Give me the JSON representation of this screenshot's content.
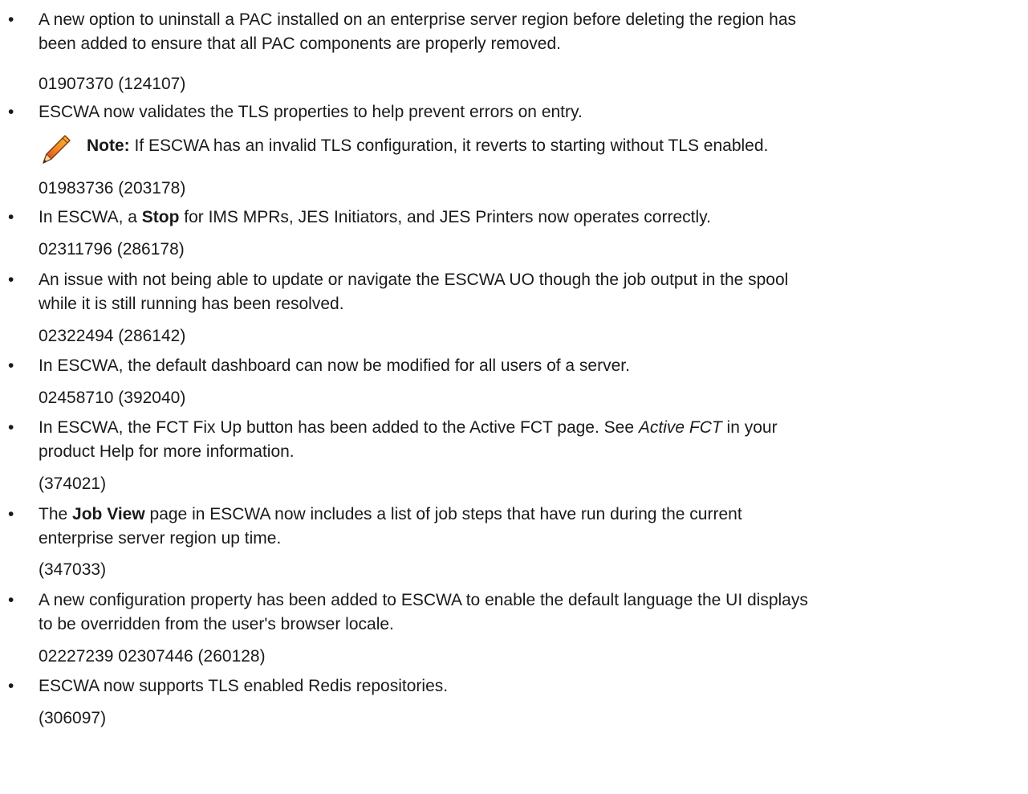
{
  "items": [
    {
      "bullet": "•",
      "text_lines": [
        "A new option to uninstall a PAC installed on an enterprise server region before deleting the region has",
        "been added to ensure that all PAC components are properly removed."
      ],
      "ref": "01907370 (124107)"
    },
    {
      "bullet": "•",
      "text": "ESCWA now validates the TLS properties to help prevent errors on entry.",
      "note_label": "Note:",
      "note_text": " If ESCWA has an invalid TLS configuration, it reverts to starting without TLS enabled.",
      "note_icon": "pencil-icon",
      "ref": "01983736 (203178)"
    },
    {
      "bullet": "•",
      "text_before": "In ESCWA, a ",
      "text_bold": "Stop",
      "text_after": " for IMS MPRs, JES Initiators, and JES Printers now operates correctly.",
      "ref": "02311796 (286178)"
    },
    {
      "bullet": "•",
      "text_lines": [
        "An issue with not being able to update or navigate the ESCWA UO though the job output in the spool",
        "while it is still running has been resolved."
      ],
      "ref": "02322494 (286142)"
    },
    {
      "bullet": "•",
      "text": "In ESCWA, the default dashboard can now be modified for all users of a server.",
      "ref": "02458710 (392040)"
    },
    {
      "bullet": "•",
      "line1_before": "In ESCWA, the FCT Fix Up button has been added to the Active FCT page. See ",
      "line1_italic": "Active FCT",
      "line1_after": " in your",
      "line2": "product Help for more information.",
      "ref": "(374021)"
    },
    {
      "bullet": "•",
      "line1_before": "The ",
      "line1_bold": "Job View",
      "line1_after": " page in ESCWA now includes a list of job steps that have run during the current",
      "line2": "enterprise server region up time.",
      "ref": "(347033)"
    },
    {
      "bullet": "•",
      "text_lines": [
        "A new configuration property has been added to ESCWA to enable the default language the UI displays",
        "to be overridden from the user's browser locale."
      ],
      "ref": "02227239 02307446 (260128)"
    },
    {
      "bullet": "•",
      "text": "ESCWA now supports TLS enabled Redis repositories.",
      "ref": "(306097)"
    }
  ]
}
